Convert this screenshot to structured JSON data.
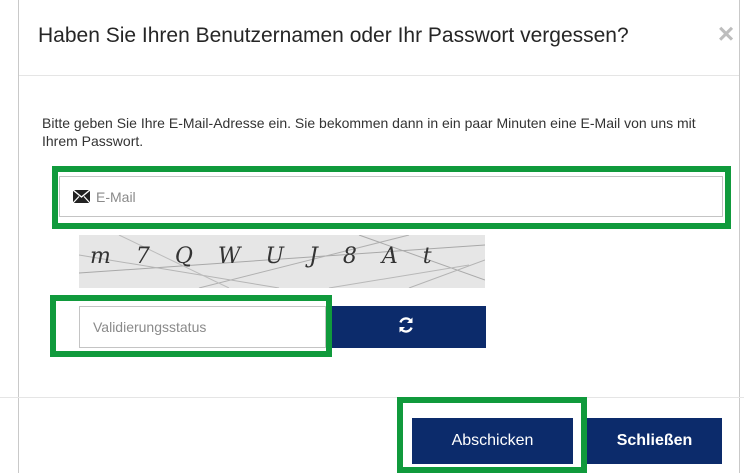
{
  "dialog": {
    "title": "Haben Sie Ihren Benutzernamen oder Ihr Passwort vergessen?",
    "close_glyph": "×",
    "intro_text": "Bitte geben Sie Ihre E-Mail-Adresse ein. Sie bekommen dann in ein paar Minuten eine E-Mail von uns mit Ihrem Passwort."
  },
  "email_field": {
    "placeholder": "E-Mail",
    "value": "",
    "icon": "envelope-icon"
  },
  "captcha": {
    "text": "m 7 Q W U J 8 A t"
  },
  "validation_field": {
    "placeholder": "Validierungsstatus",
    "value": ""
  },
  "refresh_button": {
    "icon": "refresh-icon"
  },
  "footer": {
    "submit_label": "Abschicken",
    "close_label": "Schließen"
  },
  "colors": {
    "primary": "#0c2b6b",
    "highlight": "#109a3c",
    "border": "#c4c4c4"
  }
}
